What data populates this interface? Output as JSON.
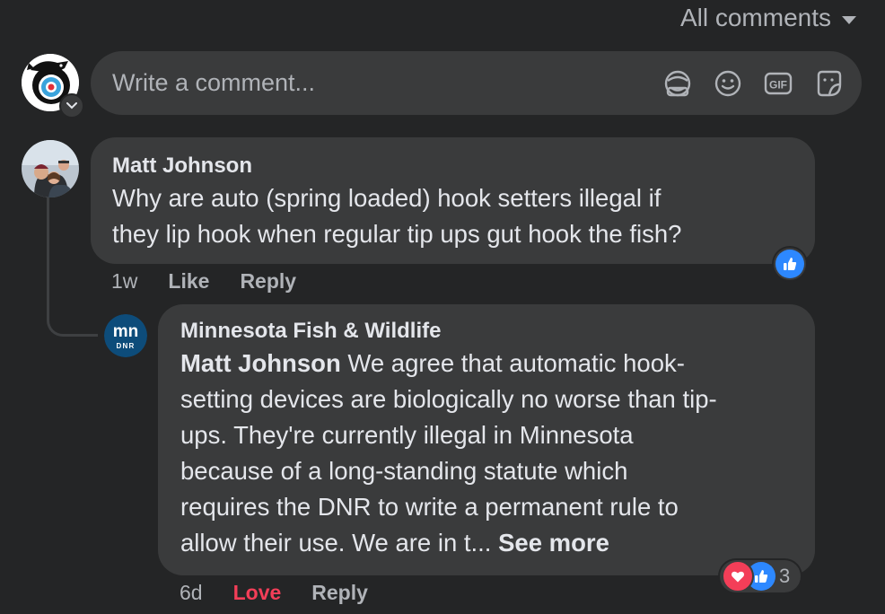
{
  "filter": {
    "label": "All comments"
  },
  "composer": {
    "placeholder": "Write a comment...",
    "icons": [
      "avatar-sticker-icon",
      "emoji-icon",
      "gif-icon",
      "sticker-icon"
    ],
    "gif_label": "GIF"
  },
  "comments": [
    {
      "author": "Matt Johnson",
      "lines": [
        "Why are auto (spring loaded) hook setters illegal if",
        "they lip hook when regular tip ups gut hook the fish?"
      ],
      "time": "1w",
      "like_label": "Like",
      "reply_label": "Reply",
      "reactions": [
        "like"
      ]
    },
    {
      "author": "Minnesota Fish & Wildlife",
      "mention": "Matt Johnson",
      "lines": [
        " We agree that automatic hook-",
        "setting devices are biologically no worse than tip-",
        "ups. They're currently illegal in Minnesota",
        "because of a long-standing statute which",
        "requires the DNR to write a permanent rule to",
        "allow their use. We are in t... "
      ],
      "see_more": "See more",
      "time": "6d",
      "like_label": "Love",
      "reply_label": "Reply",
      "reactions": [
        "love",
        "like"
      ],
      "reaction_count": "3",
      "avatar_text": {
        "top": "mn",
        "bottom": "DNR"
      }
    }
  ],
  "colors": {
    "background": "#242526",
    "bubble": "#3a3b3c",
    "primary_text": "#e4e6eb",
    "secondary_text": "#b0b3b8",
    "love": "#f33e58",
    "like": "#2d88ff"
  }
}
